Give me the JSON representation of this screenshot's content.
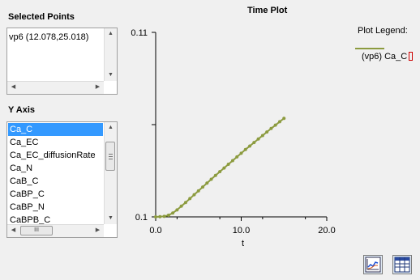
{
  "selected_points": {
    "title": "Selected Points",
    "items": [
      "vp6 (12.078,25.018)"
    ]
  },
  "y_axis": {
    "title": "Y Axis",
    "items": [
      "Ca_C",
      "Ca_EC",
      "Ca_EC_diffusionRate",
      "Ca_N",
      "CaB_C",
      "CaBP_C",
      "CaBP_N",
      "CaBPB_C"
    ],
    "selected": "Ca_C",
    "hscroll_thumb": "III"
  },
  "plot": {
    "title": "Time Plot",
    "legend_title": "Plot Legend:",
    "legend_entry": "(vp6) Ca_C",
    "series_color": "#8c9b3f"
  },
  "chart_data": {
    "type": "line",
    "title": "Time Plot",
    "xlabel": "t",
    "ylabel": "",
    "xlim": [
      0.0,
      20.0
    ],
    "ylim": [
      0.1,
      0.11
    ],
    "x_ticks": [
      "0.0",
      "10.0",
      "20.0"
    ],
    "y_ticks": [
      "0.11",
      "0.1"
    ],
    "series": [
      {
        "name": "(vp6) Ca_C",
        "x": [
          0.0,
          0.5,
          1.0,
          1.5,
          2.0,
          2.5,
          3.0,
          3.5,
          4.0,
          4.5,
          5.0,
          5.5,
          6.0,
          6.5,
          7.0,
          7.5,
          8.0,
          8.5,
          9.0,
          9.5,
          10.0,
          10.5,
          11.0,
          11.5,
          12.0,
          12.5,
          13.0,
          13.5,
          14.0,
          14.5,
          15.0
        ],
        "y": [
          0.1,
          0.10001,
          0.10003,
          0.10009,
          0.10021,
          0.10038,
          0.10058,
          0.10078,
          0.10099,
          0.1012,
          0.10141,
          0.10162,
          0.10183,
          0.10204,
          0.10225,
          0.10245,
          0.10265,
          0.10285,
          0.10305,
          0.10325,
          0.10345,
          0.10365,
          0.10384,
          0.10403,
          0.10422,
          0.10441,
          0.1046,
          0.10479,
          0.10497,
          0.10516,
          0.10534
        ]
      }
    ]
  }
}
